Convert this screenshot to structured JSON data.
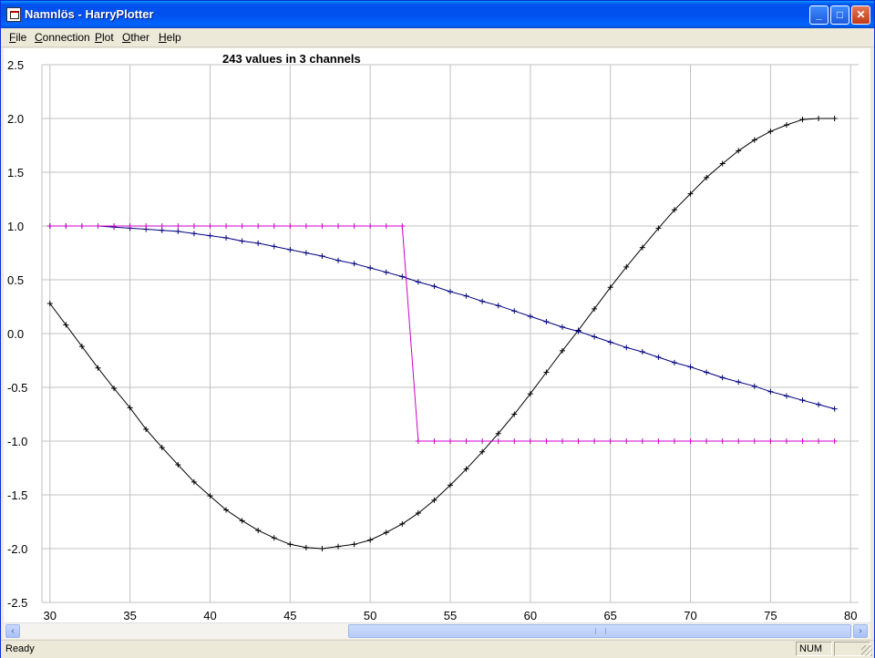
{
  "window": {
    "title": "Namnlös - HarryPlotter",
    "min_glyph": "_",
    "max_glyph": "□",
    "close_glyph": "✕"
  },
  "menu": {
    "items": [
      {
        "label": "File",
        "u": "F",
        "rest": "ile"
      },
      {
        "label": "Connection",
        "u": "C",
        "rest": "onnection"
      },
      {
        "label": "Plot",
        "u": "P",
        "rest": "lot"
      },
      {
        "label": "Other",
        "u": "O",
        "rest": "ther"
      },
      {
        "label": "Help",
        "u": "H",
        "rest": "elp"
      }
    ]
  },
  "status": {
    "text": "Ready",
    "num": "NUM"
  },
  "scrollbar": {
    "left_glyph": "‹",
    "right_glyph": "›"
  },
  "colors": {
    "plot_bg": "#ffffff",
    "grid": "#c0c0c0",
    "series_sin": "#000000",
    "series_cos": "#000080",
    "series_square": "#cc00cc"
  },
  "chart_data": {
    "type": "line",
    "title": "243 values in 3 channels",
    "xlabel": "",
    "ylabel": "",
    "xlim": [
      29.5,
      80.5
    ],
    "ylim": [
      -2.5,
      2.5
    ],
    "xticks": [
      30,
      35,
      40,
      45,
      50,
      55,
      60,
      65,
      70,
      75,
      80
    ],
    "yticks": [
      "2.5",
      "2.0",
      "1.5",
      "1.0",
      "0.5",
      "0.0",
      "-0.5",
      "-1.0",
      "-1.5",
      "-2.0",
      "-2.5"
    ],
    "grid": true,
    "x": [
      30,
      31,
      32,
      33,
      34,
      35,
      36,
      37,
      38,
      39,
      40,
      41,
      42,
      43,
      44,
      45,
      46,
      47,
      48,
      49,
      50,
      51,
      52,
      53,
      54,
      55,
      56,
      57,
      58,
      59,
      60,
      61,
      62,
      63,
      64,
      65,
      66,
      67,
      68,
      69,
      70,
      71,
      72,
      73,
      74,
      75,
      76,
      77,
      78,
      79
    ],
    "series": [
      {
        "color": "#000000",
        "marker": "+",
        "values": [
          0.28,
          0.08,
          -0.12,
          -0.32,
          -0.51,
          -0.69,
          -0.89,
          -1.06,
          -1.22,
          -1.38,
          -1.51,
          -1.64,
          -1.74,
          -1.83,
          -1.9,
          -1.96,
          -1.99,
          -2.0,
          -1.98,
          -1.96,
          -1.92,
          -1.85,
          -1.77,
          -1.67,
          -1.55,
          -1.41,
          -1.26,
          -1.1,
          -0.93,
          -0.75,
          -0.56,
          -0.36,
          -0.16,
          0.03,
          0.23,
          0.43,
          0.62,
          0.8,
          0.98,
          1.15,
          1.3,
          1.45,
          1.58,
          1.7,
          1.8,
          1.88,
          1.94,
          1.99,
          2.0,
          2.0
        ]
      },
      {
        "color": "#000080",
        "marker": "+",
        "values": [
          1.0,
          1.0,
          1.0,
          1.0,
          0.99,
          0.98,
          0.97,
          0.96,
          0.95,
          0.93,
          0.91,
          0.89,
          0.86,
          0.84,
          0.81,
          0.78,
          0.75,
          0.72,
          0.68,
          0.65,
          0.61,
          0.57,
          0.53,
          0.48,
          0.44,
          0.39,
          0.35,
          0.3,
          0.26,
          0.21,
          0.16,
          0.11,
          0.06,
          0.02,
          -0.03,
          -0.08,
          -0.13,
          -0.17,
          -0.22,
          -0.27,
          -0.31,
          -0.36,
          -0.41,
          -0.45,
          -0.49,
          -0.54,
          -0.58,
          -0.62,
          -0.66,
          -0.7
        ]
      },
      {
        "color": "#cc00cc",
        "marker": "+",
        "values": [
          1,
          1,
          1,
          1,
          1,
          1,
          1,
          1,
          1,
          1,
          1,
          1,
          1,
          1,
          1,
          1,
          1,
          1,
          1,
          1,
          1,
          1,
          1,
          -1,
          -1,
          -1,
          -1,
          -1,
          -1,
          -1,
          -1,
          -1,
          -1,
          -1,
          -1,
          -1,
          -1,
          -1,
          -1,
          -1,
          -1,
          -1,
          -1,
          -1,
          -1,
          -1,
          -1,
          -1,
          -1,
          -1
        ]
      }
    ]
  }
}
